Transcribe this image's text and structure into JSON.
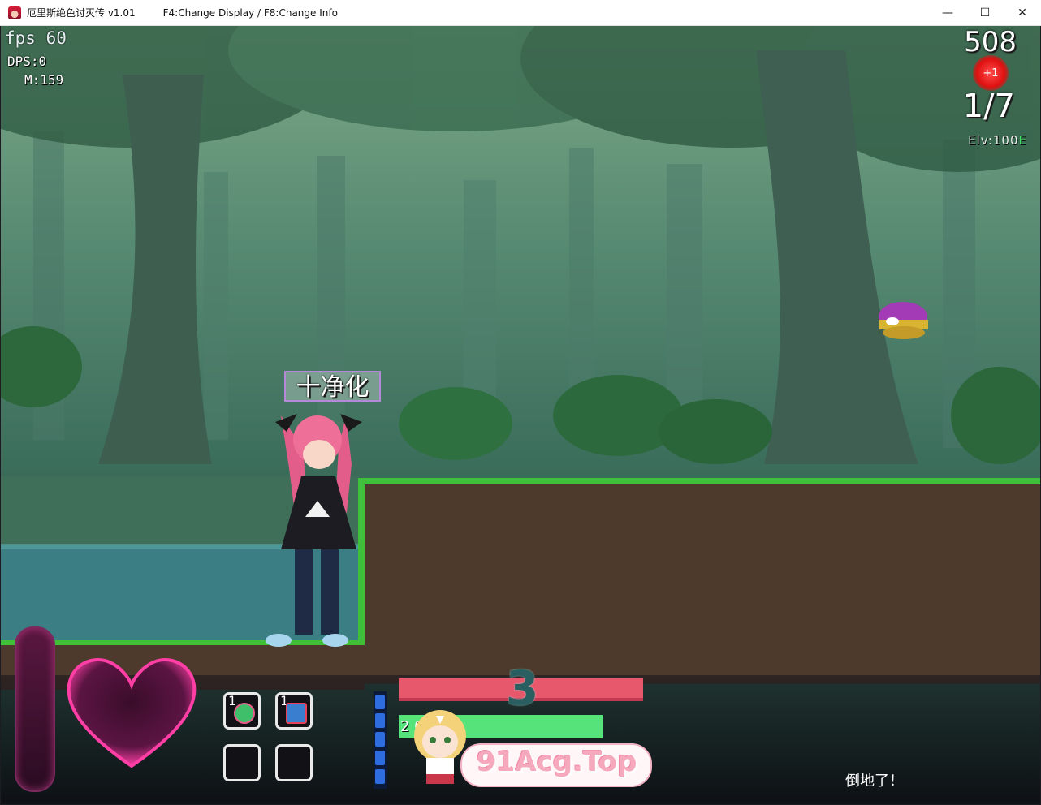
{
  "window": {
    "title": "厄里斯绝色讨灭传 v1.01",
    "info": "F4:Change Display / F8:Change Info",
    "minimize_glyph": "—",
    "maximize_glyph": "☐",
    "close_glyph": "✕"
  },
  "debug": {
    "fps": "fps 60",
    "dps": "DPS:0",
    "mem": "M:159"
  },
  "hud": {
    "score": "508",
    "plus_badge": "+1",
    "stage": "1/7",
    "elv_prefix": "Elv:100",
    "elv_suffix": "E",
    "skill_label": "十净化",
    "level_number": "3",
    "mp_text": "2          0",
    "items": [
      {
        "count": "1",
        "icon": "heal-potion-icon"
      },
      {
        "count": "1",
        "icon": "hp-up-icon"
      },
      {
        "count": "",
        "icon": "empty-slot"
      },
      {
        "count": "",
        "icon": "empty-slot"
      }
    ],
    "status_message": "倒地了！"
  },
  "watermark": {
    "text": "91Acg.Top"
  },
  "colors": {
    "hp_bar": "#e8586c",
    "mp_bar": "#56e37a",
    "gauge": "#5a1740",
    "heart": "#ff3fa5",
    "ground": "#4e3a2c",
    "grass": "#3fbf3a"
  }
}
